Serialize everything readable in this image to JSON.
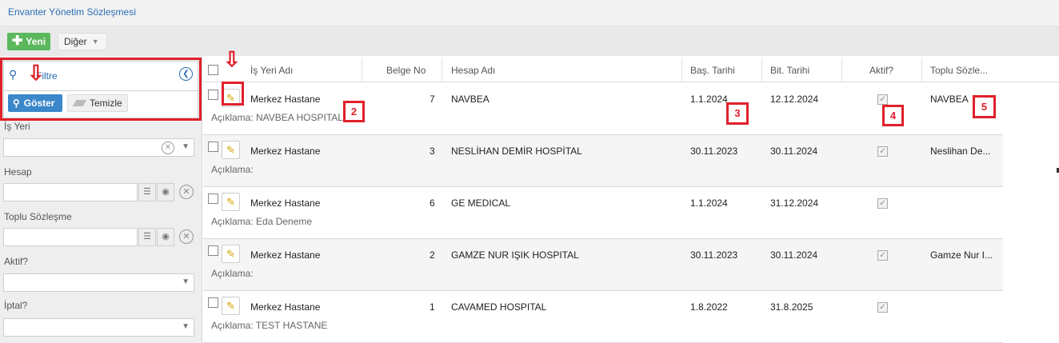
{
  "page": {
    "title": "Envanter Yönetim Sözleşmesi"
  },
  "toolbar": {
    "new_label": "Yeni",
    "other_label": "Diğer"
  },
  "filter": {
    "header_label": "Filtre",
    "show_label": "Göster",
    "clear_label": "Temizle",
    "fields": {
      "workplace_label": "İş Yeri",
      "account_label": "Hesap",
      "bulk_contract_label": "Toplu Sözleşme",
      "active_label": "Aktif?",
      "cancel_label": "İptal?"
    }
  },
  "grid": {
    "columns": [
      "İş Yeri Adı",
      "Belge No",
      "Hesap Adı",
      "Baş. Tarihi",
      "Bit. Tarihi",
      "Aktif?",
      "Toplu Sözle..."
    ],
    "description_prefix": "Açıklama:",
    "rows": [
      {
        "workplace": "Merkez Hastane",
        "doc_no": "7",
        "account": "NAVBEA",
        "start": "1.1.2024",
        "end": "12.12.2024",
        "bulk": "NAVBEA",
        "desc": "Açıklama: NAVBEA HOSPITAL"
      },
      {
        "workplace": "Merkez Hastane",
        "doc_no": "3",
        "account": "NESLİHAN DEMİR HOSPİTAL",
        "start": "30.11.2023",
        "end": "30.11.2024",
        "bulk": "Neslihan De...",
        "desc": "Açıklama:"
      },
      {
        "workplace": "Merkez Hastane",
        "doc_no": "6",
        "account": "GE MEDICAL",
        "start": "1.1.2024",
        "end": "31.12.2024",
        "bulk": "",
        "desc": "Açıklama: Eda Deneme"
      },
      {
        "workplace": "Merkez Hastane",
        "doc_no": "2",
        "account": "GAMZE NUR IŞIK HOSPITAL",
        "start": "30.11.2023",
        "end": "30.11.2024",
        "bulk": "Gamze Nur I...",
        "desc": "Açıklama:"
      },
      {
        "workplace": "Merkez Hastane",
        "doc_no": "1",
        "account": "CAVAMED HOSPITAL",
        "start": "1.8.2022",
        "end": "31.8.2025",
        "bulk": "",
        "desc": "Açıklama: TEST HASTANE"
      }
    ]
  },
  "annotations": {
    "n2": "2",
    "n3": "3",
    "n4": "4",
    "n5": "5"
  },
  "colors": {
    "accent": "#2a6bb3",
    "new_button": "#5cb85c",
    "show_button": "#3a87c9",
    "annotation": "#e0202a"
  }
}
